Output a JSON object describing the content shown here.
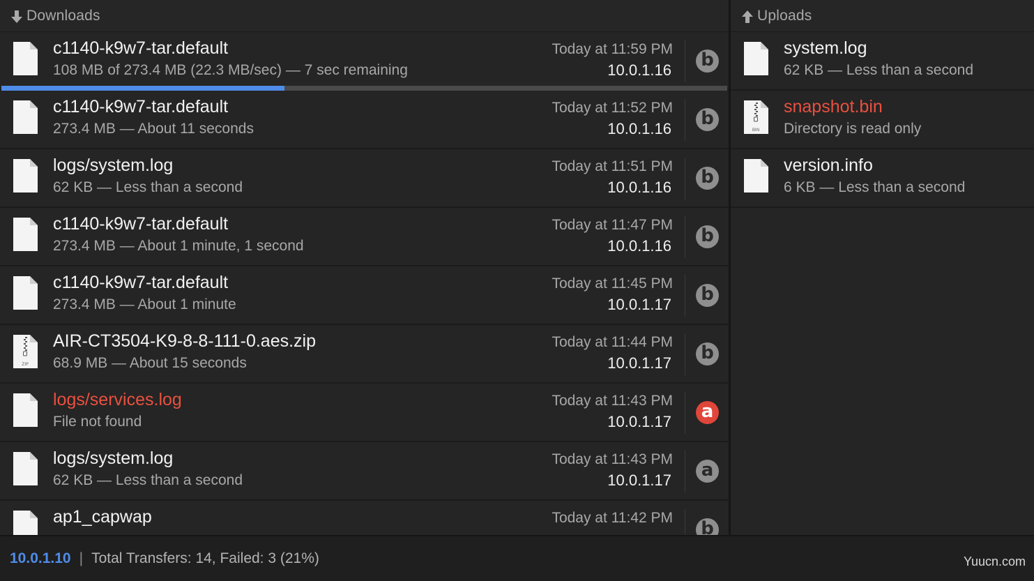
{
  "downloads": {
    "title": "Downloads",
    "rows": [
      {
        "name": "c1140-k9w7-tar.default",
        "detail": "108 MB of 273.4 MB (22.3 MB/sec) — 7 sec remaining",
        "time": "Today at 11:59 PM",
        "host": "10.0.1.16",
        "badge": "b",
        "status": "active",
        "file_type": "generic",
        "progress": 0.39
      },
      {
        "name": "c1140-k9w7-tar.default",
        "detail": "273.4 MB — About 11 seconds",
        "time": "Today at 11:52 PM",
        "host": "10.0.1.16",
        "badge": "b",
        "status": "done",
        "file_type": "generic"
      },
      {
        "name": "logs/system.log",
        "detail": "62 KB — Less than a second",
        "time": "Today at 11:51 PM",
        "host": "10.0.1.16",
        "badge": "b",
        "status": "done",
        "file_type": "generic"
      },
      {
        "name": "c1140-k9w7-tar.default",
        "detail": "273.4 MB — About 1 minute, 1 second",
        "time": "Today at 11:47 PM",
        "host": "10.0.1.16",
        "badge": "b",
        "status": "done",
        "file_type": "generic"
      },
      {
        "name": "c1140-k9w7-tar.default",
        "detail": "273.4 MB — About 1 minute",
        "time": "Today at 11:45 PM",
        "host": "10.0.1.17",
        "badge": "b",
        "status": "done",
        "file_type": "generic"
      },
      {
        "name": "AIR-CT3504-K9-8-8-111-0.aes.zip",
        "detail": "68.9 MB — About 15 seconds",
        "time": "Today at 11:44 PM",
        "host": "10.0.1.17",
        "badge": "b",
        "status": "done",
        "file_type": "zip"
      },
      {
        "name": "logs/services.log",
        "detail": "File not found",
        "time": "Today at 11:43 PM",
        "host": "10.0.1.17",
        "badge": "a",
        "status": "error",
        "file_type": "generic"
      },
      {
        "name": "logs/system.log",
        "detail": "62 KB — Less than a second",
        "time": "Today at 11:43 PM",
        "host": "10.0.1.17",
        "badge": "a",
        "status": "done",
        "file_type": "generic"
      },
      {
        "name": "ap1_capwap",
        "detail": "",
        "time": "Today at 11:42 PM",
        "host": "",
        "badge": "b",
        "status": "done",
        "file_type": "generic"
      }
    ]
  },
  "uploads": {
    "title": "Uploads",
    "rows": [
      {
        "name": "system.log",
        "detail": "62 KB — Less than a second",
        "status": "done",
        "file_type": "generic"
      },
      {
        "name": "snapshot.bin",
        "detail": "Directory is read only",
        "status": "error",
        "file_type": "bin"
      },
      {
        "name": "version.info",
        "detail": "6 KB — Less than a second",
        "status": "done",
        "file_type": "generic"
      }
    ]
  },
  "status_bar": {
    "ip": "10.0.1.10",
    "separator": "|",
    "summary": "Total Transfers: 14, Failed: 3 (21%)",
    "watermark": "Yuucn.com"
  },
  "icons": {
    "downloads_header": "arrow-down-icon",
    "uploads_header": "arrow-up-icon",
    "file": "document-icon",
    "zip_file": "zip-document-icon",
    "bin_file": "bin-document-icon",
    "badge": "protocol-badge-icon"
  },
  "colors": {
    "accent": "#4f8ce9",
    "error": "#e9503f",
    "badge_error": "#e0463a",
    "badge_normal": "#8f8f8f",
    "background": "#252525"
  }
}
